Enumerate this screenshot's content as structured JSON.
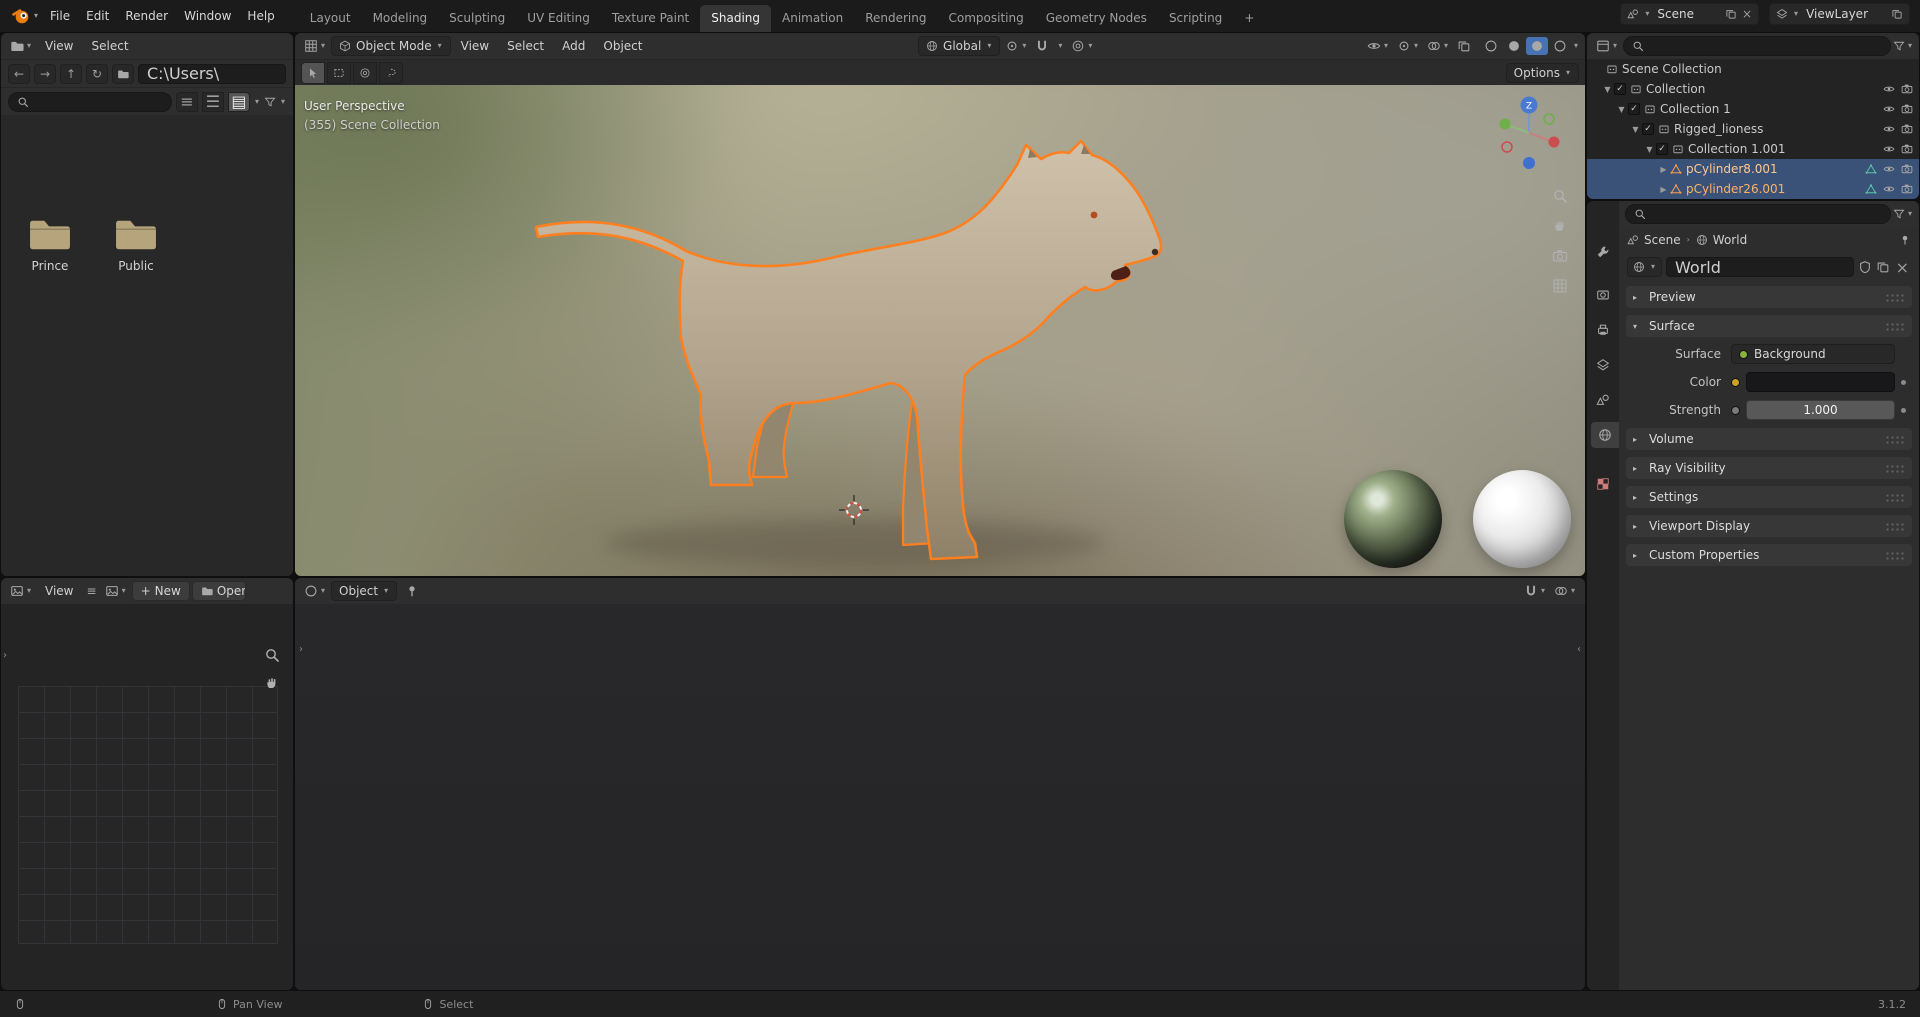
{
  "colors": {
    "accent_blue": "#4772b3",
    "selection_outline_orange": "#ff7f1f",
    "selected_row_blue": "#3a5277",
    "selected_object_text": "#ffb066",
    "active_object_text": "#ffc893",
    "topbar_bg": "#1b1b1b",
    "header_bg": "#2e2e2e"
  },
  "topbar": {
    "menus": [
      "File",
      "Edit",
      "Render",
      "Window",
      "Help"
    ],
    "workspaces": [
      "Layout",
      "Modeling",
      "Sculpting",
      "UV Editing",
      "Texture Paint",
      "Shading",
      "Animation",
      "Rendering",
      "Compositing",
      "Geometry Nodes",
      "Scripting"
    ],
    "add_tab": "+",
    "scene": "Scene",
    "view_layer": "ViewLayer"
  },
  "file_browser": {
    "view_menu": "View",
    "select_menu": "Select",
    "path": "C:\\Users\\",
    "folders": [
      {
        "name": "Prince"
      },
      {
        "name": "Public"
      }
    ]
  },
  "viewport": {
    "mode": "Object Mode",
    "menus": [
      "View",
      "Select",
      "Add",
      "Object"
    ],
    "orientation": "Global",
    "options": "Options",
    "overlay_perspective": "User Perspective",
    "overlay_collection": "(355) Scene Collection",
    "gizmo_z": "Z"
  },
  "image_editor": {
    "view_menu": "View",
    "new_button": "New",
    "open_button": "Open"
  },
  "shader_editor": {
    "type_selector": "Object"
  },
  "outliner": {
    "rows": [
      {
        "label": "Scene Collection"
      },
      {
        "label": "Collection"
      },
      {
        "label": "Collection 1"
      },
      {
        "label": "Rigged_lioness"
      },
      {
        "label": "Collection 1.001"
      },
      {
        "label": "pCylinder8.001"
      },
      {
        "label": "pCylinder26.001"
      }
    ]
  },
  "properties": {
    "breadcrumb_scene": "Scene",
    "breadcrumb_world": "World",
    "world_name": "World",
    "panel_preview": "Preview",
    "panel_surface": "Surface",
    "panel_volume": "Volume",
    "panel_ray_visibility": "Ray Visibility",
    "panel_settings": "Settings",
    "panel_viewport_display": "Viewport Display",
    "panel_custom_properties": "Custom Properties",
    "surface_label": "Surface",
    "surface_value": "Background",
    "color_label": "Color",
    "strength_label": "Strength",
    "strength_value": "1.000"
  },
  "statusbar": {
    "pan_view": "Pan View",
    "select": "Select",
    "version": "3.1.2"
  }
}
